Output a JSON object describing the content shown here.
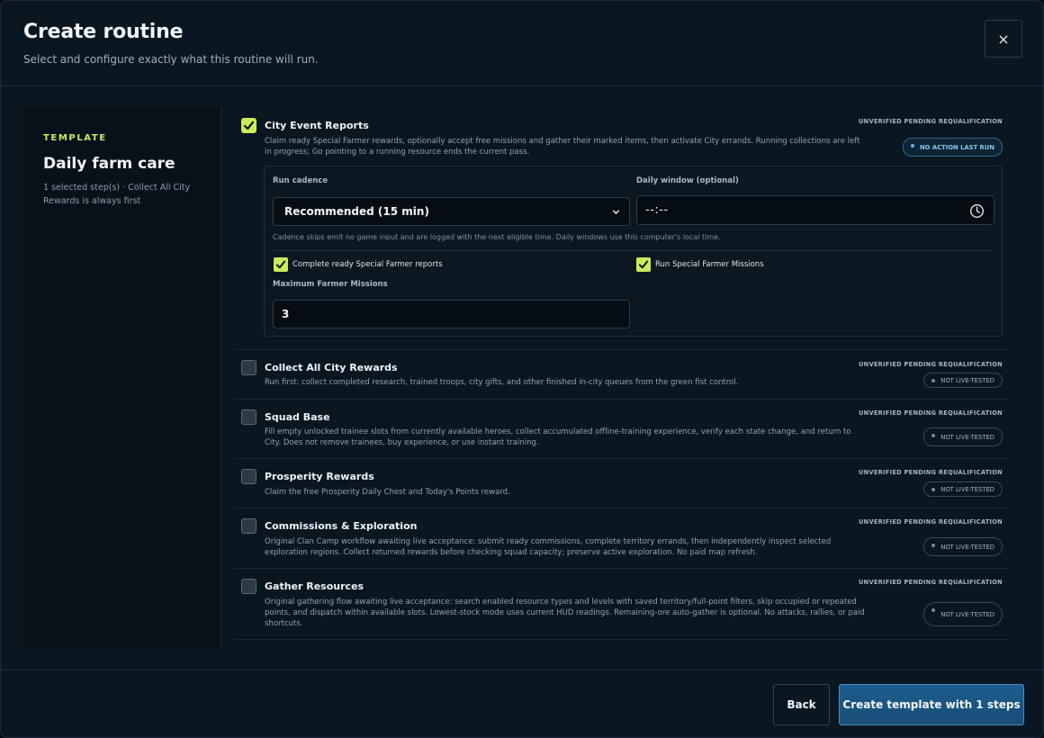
{
  "header": {
    "title": "Create routine",
    "subtitle": "Select and configure exactly what this routine will run.",
    "close_symbol": "×"
  },
  "sidebar": {
    "eyebrow": "TEMPLATE",
    "title": "Daily farm care",
    "description": "1 selected step(s) · Collect All City Rewards is always first"
  },
  "steps": [
    {
      "title": "City Event Reports",
      "description": "Claim ready Special Farmer rewards, optionally accept free missions and gather their marked items, then activate City errands. Running collections are left in progress; Go pointing to a running resource ends the current pass.",
      "status": "UNVERIFIED PENDING REQUALIFICATION",
      "badge": "NO ACTION LAST RUN",
      "checked": true
    },
    {
      "title": "Collect All City Rewards",
      "description": "Run first: collect completed research, trained troops, city gifts, and other finished in-city queues from the green fist control.",
      "status": "UNVERIFIED PENDING REQUALIFICATION",
      "badge": "NOT LIVE-TESTED",
      "checked": false
    },
    {
      "title": "Squad Base",
      "description": "Fill empty unlocked trainee slots from currently available heroes, collect accumulated offline-training experience, verify each state change, and return to City. Does not remove trainees, buy experience, or use instant training.",
      "status": "UNVERIFIED PENDING REQUALIFICATION",
      "badge": "NOT LIVE-TESTED",
      "checked": false
    },
    {
      "title": "Prosperity Rewards",
      "description": "Claim the free Prosperity Daily Chest and Today's Points reward.",
      "status": "UNVERIFIED PENDING REQUALIFICATION",
      "badge": "NOT LIVE-TESTED",
      "checked": false
    },
    {
      "title": "Commissions & Exploration",
      "description": "Original Clan Camp workflow awaiting live acceptance: submit ready commissions, complete territory errands, then independently inspect selected exploration regions. Collect returned rewards before checking squad capacity; preserve active exploration. No paid map refresh.",
      "status": "UNVERIFIED PENDING REQUALIFICATION",
      "badge": "NOT LIVE-TESTED",
      "checked": false
    },
    {
      "title": "Gather Resources",
      "description": "Original gathering flow awaiting live acceptance: search enabled resource types and levels with saved territory/full-point filters, skip occupied or repeated points, and dispatch within available slots. Lowest-stock mode uses current HUD readings. Remaining-ore auto-gather is optional. No attacks, rallies, or paid shortcuts.",
      "status": "UNVERIFIED PENDING REQUALIFICATION",
      "badge": "NOT LIVE-TESTED",
      "checked": false
    }
  ],
  "config": {
    "cadence_label": "Run cadence",
    "cadence_value": "Recommended (15 min)",
    "window_label": "Daily window (optional)",
    "window_value": "--:--",
    "hint": "Cadence skips emit no game input and are logged with the next eligible time. Daily windows use this computer's local time.",
    "option1": "Complete ready Special Farmer reports",
    "option2": "Run Special Farmer Missions",
    "max_label": "Maximum Farmer Missions",
    "max_value": "3"
  },
  "footer": {
    "back": "Back",
    "create": "Create template with 1 steps"
  },
  "colors": {
    "accent": "#c8ec5b",
    "primary": "#1f5d8c",
    "background": "#0a1620"
  }
}
